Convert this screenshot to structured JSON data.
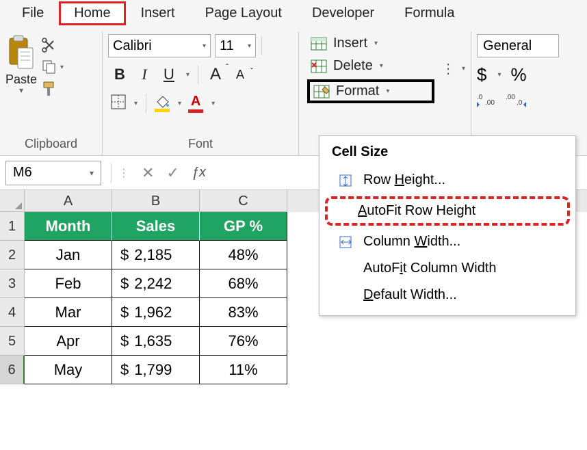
{
  "menu": {
    "file": "File",
    "home": "Home",
    "insert": "Insert",
    "page_layout": "Page Layout",
    "developer": "Developer",
    "formula": "Formula"
  },
  "ribbon": {
    "clipboard": {
      "label": "Clipboard",
      "paste": "Paste"
    },
    "font": {
      "label": "Font",
      "name": "Calibri",
      "size": "11",
      "bold": "B",
      "italic": "I",
      "underline": "U",
      "increase": "A",
      "decrease": "A",
      "fill_char": "A",
      "font_color_char": "A"
    },
    "cells": {
      "insert": "Insert",
      "delete": "Delete",
      "format": "Format"
    },
    "number": {
      "general": "General",
      "currency": "$",
      "percent": "%",
      "inc_dec": ".0",
      "dec_dec": ".00"
    }
  },
  "namebox": {
    "ref": "M6"
  },
  "grid": {
    "cols": [
      "A",
      "B",
      "C"
    ],
    "headers": {
      "month": "Month",
      "sales": "Sales",
      "gp": "GP %"
    },
    "rows": [
      {
        "n": "1"
      },
      {
        "n": "2",
        "month": "Jan",
        "sales": "2,185",
        "gp": "48%"
      },
      {
        "n": "3",
        "month": "Feb",
        "sales": "2,242",
        "gp": "68%"
      },
      {
        "n": "4",
        "month": "Mar",
        "sales": "1,962",
        "gp": "83%"
      },
      {
        "n": "5",
        "month": "Apr",
        "sales": "1,635",
        "gp": "76%"
      },
      {
        "n": "6",
        "month": "May",
        "sales": "1,799",
        "gp": "11%"
      }
    ],
    "currency": "$"
  },
  "format_menu": {
    "header": "Cell Size",
    "row_height": "Row Height...",
    "autofit_row": "AutoFit Row Height",
    "col_width": "Column Width...",
    "autofit_col": "AutoFit Column Width",
    "default_width": "Default Width..."
  }
}
